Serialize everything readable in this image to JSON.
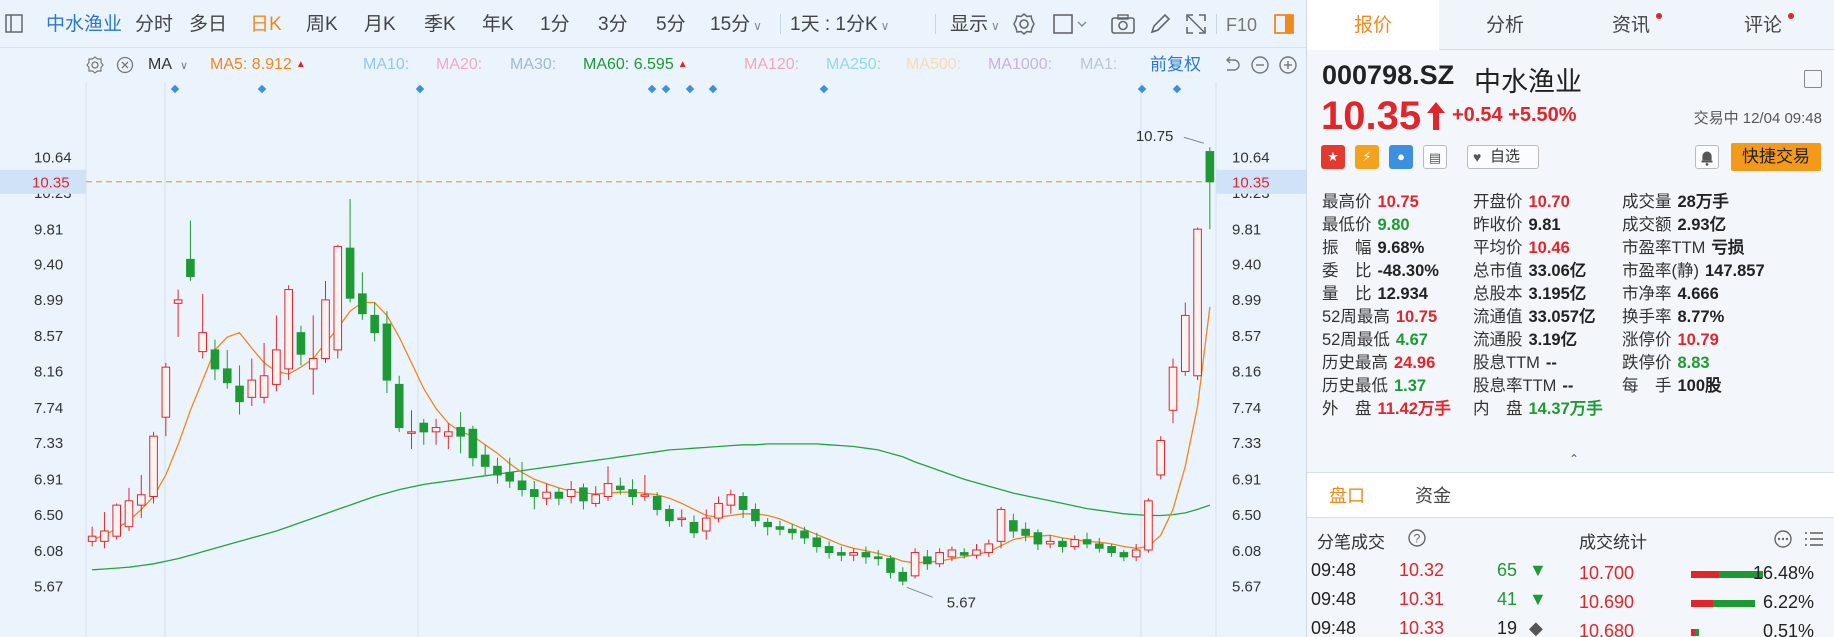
{
  "toolbar": {
    "stock_name": "中水渔业",
    "periods": [
      "分时",
      "多日",
      "日K",
      "周K",
      "月K",
      "季K",
      "年K",
      "1分",
      "3分",
      "5分",
      "15分"
    ],
    "active_period": "日K",
    "combo": "1天 : 1分K",
    "display": "显示",
    "f10": "F10"
  },
  "ma_row": {
    "ma_label": "MA",
    "items": [
      {
        "text": "MA5:  8.912",
        "color": "#f0871d",
        "arrow": "▲"
      },
      {
        "text": "MA10:",
        "color": "#8fc8f3",
        "arrow": ""
      },
      {
        "text": "MA20:",
        "color": "#f2a8c7",
        "arrow": ""
      },
      {
        "text": "MA30:",
        "color": "#9fb7d8",
        "arrow": ""
      },
      {
        "text": "MA60:  6.595",
        "color": "#1e9a35",
        "arrow": "▲"
      },
      {
        "text": "MA120:",
        "color": "#f2a8b8",
        "arrow": ""
      },
      {
        "text": "MA250:",
        "color": "#8fd8ef",
        "arrow": ""
      },
      {
        "text": "MA500:",
        "color": "#f7dcb0",
        "arrow": ""
      },
      {
        "text": "MA1000:",
        "color": "#c9b2e3",
        "arrow": ""
      },
      {
        "text": "MA1:",
        "color": "#b9c6d8",
        "arrow": ""
      }
    ],
    "adjust": "前复权"
  },
  "chart_data": {
    "type": "candlestick",
    "y_ticks": [
      "10.64",
      "10.23",
      "9.81",
      "9.40",
      "8.99",
      "8.57",
      "8.16",
      "7.74",
      "7.33",
      "6.91",
      "6.50",
      "6.08",
      "5.67"
    ],
    "ylim": [
      5.5,
      10.95
    ],
    "current_price": "10.35",
    "max_label": "10.75",
    "min_label": "5.67",
    "candles": [
      [
        6.18,
        6.24,
        6.35,
        6.12
      ],
      [
        6.18,
        6.3,
        6.52,
        6.1
      ],
      [
        6.24,
        6.6,
        6.62,
        6.2
      ],
      [
        6.35,
        6.65,
        6.8,
        6.3
      ],
      [
        6.6,
        6.72,
        6.95,
        6.45
      ],
      [
        6.7,
        7.4,
        7.45,
        6.62
      ],
      [
        7.62,
        8.2,
        8.25,
        7.4
      ],
      [
        8.94,
        8.98,
        9.1,
        8.55
      ],
      [
        9.45,
        9.25,
        9.9,
        9.2
      ],
      [
        8.38,
        8.6,
        9.05,
        8.3
      ],
      [
        8.4,
        8.18,
        8.52,
        8.05
      ],
      [
        8.18,
        8.02,
        8.4,
        7.95
      ],
      [
        7.98,
        7.8,
        8.22,
        7.65
      ],
      [
        7.85,
        8.05,
        8.3,
        7.75
      ],
      [
        7.85,
        8.1,
        8.48,
        7.78
      ],
      [
        8.0,
        8.4,
        8.8,
        7.92
      ],
      [
        8.18,
        9.1,
        9.15,
        8.05
      ],
      [
        8.6,
        8.35,
        8.68,
        8.22
      ],
      [
        8.18,
        8.3,
        8.8,
        7.88
      ],
      [
        8.3,
        8.98,
        9.2,
        8.25
      ],
      [
        8.4,
        9.6,
        9.62,
        8.3
      ],
      [
        9.58,
        9.0,
        10.15,
        8.95
      ],
      [
        9.05,
        8.82,
        9.3,
        8.75
      ],
      [
        8.8,
        8.6,
        8.95,
        8.5
      ],
      [
        8.7,
        8.05,
        8.85,
        7.9
      ],
      [
        8.0,
        7.5,
        8.1,
        7.45
      ],
      [
        7.45,
        7.45,
        7.7,
        7.25
      ],
      [
        7.55,
        7.45,
        7.6,
        7.3
      ],
      [
        7.45,
        7.5,
        7.6,
        7.3
      ],
      [
        7.4,
        7.45,
        7.55,
        7.25
      ],
      [
        7.5,
        7.4,
        7.68,
        7.2
      ],
      [
        7.48,
        7.15,
        7.52,
        7.05
      ],
      [
        7.18,
        7.05,
        7.3,
        6.95
      ],
      [
        7.05,
        6.95,
        7.15,
        6.85
      ],
      [
        6.98,
        6.88,
        7.15,
        6.8
      ],
      [
        6.88,
        6.78,
        7.1,
        6.7
      ],
      [
        6.78,
        6.7,
        6.88,
        6.55
      ],
      [
        6.68,
        6.75,
        6.85,
        6.6
      ],
      [
        6.75,
        6.68,
        6.8,
        6.6
      ],
      [
        6.7,
        6.78,
        6.88,
        6.62
      ],
      [
        6.8,
        6.65,
        6.85,
        6.55
      ],
      [
        6.62,
        6.72,
        6.82,
        6.58
      ],
      [
        6.7,
        6.85,
        7.05,
        6.65
      ],
      [
        6.82,
        6.78,
        6.92,
        6.72
      ],
      [
        6.78,
        6.7,
        6.9,
        6.6
      ],
      [
        6.72,
        6.72,
        6.95,
        6.65
      ],
      [
        6.7,
        6.55,
        6.75,
        6.48
      ],
      [
        6.55,
        6.42,
        6.6,
        6.35
      ],
      [
        6.45,
        6.45,
        6.55,
        6.35
      ],
      [
        6.4,
        6.28,
        6.48,
        6.22
      ],
      [
        6.3,
        6.45,
        6.55,
        6.2
      ],
      [
        6.45,
        6.62,
        6.7,
        6.4
      ],
      [
        6.6,
        6.72,
        6.78,
        6.5
      ],
      [
        6.7,
        6.55,
        6.75,
        6.45
      ],
      [
        6.55,
        6.42,
        6.62,
        6.35
      ],
      [
        6.4,
        6.35,
        6.45,
        6.25
      ],
      [
        6.35,
        6.32,
        6.42,
        6.25
      ],
      [
        6.32,
        6.28,
        6.38,
        6.2
      ],
      [
        6.3,
        6.22,
        6.35,
        6.15
      ],
      [
        6.22,
        6.12,
        6.28,
        6.05
      ],
      [
        6.12,
        6.05,
        6.18,
        5.98
      ],
      [
        6.05,
        6.02,
        6.12,
        5.95
      ],
      [
        6.02,
        6.05,
        6.1,
        5.95
      ],
      [
        6.05,
        6.0,
        6.12,
        5.92
      ],
      [
        6.0,
        5.98,
        6.08,
        5.9
      ],
      [
        5.98,
        5.82,
        6.02,
        5.75
      ],
      [
        5.82,
        5.72,
        5.88,
        5.67
      ],
      [
        5.78,
        6.05,
        6.1,
        5.75
      ],
      [
        6.0,
        5.92,
        6.08,
        5.85
      ],
      [
        5.92,
        6.05,
        6.1,
        5.88
      ],
      [
        6.0,
        6.08,
        6.12,
        5.95
      ],
      [
        6.05,
        6.02,
        6.1,
        5.98
      ],
      [
        6.02,
        6.08,
        6.15,
        5.98
      ],
      [
        6.05,
        6.15,
        6.2,
        6.0
      ],
      [
        6.18,
        6.55,
        6.58,
        6.1
      ],
      [
        6.42,
        6.3,
        6.5,
        6.22
      ],
      [
        6.32,
        6.25,
        6.4,
        6.18
      ],
      [
        6.28,
        6.15,
        6.32,
        6.08
      ],
      [
        6.15,
        6.18,
        6.25,
        6.1
      ],
      [
        6.18,
        6.12,
        6.22,
        6.05
      ],
      [
        6.12,
        6.2,
        6.25,
        6.08
      ],
      [
        6.2,
        6.15,
        6.28,
        6.1
      ],
      [
        6.15,
        6.1,
        6.22,
        6.05
      ],
      [
        6.12,
        6.05,
        6.15,
        6.0
      ],
      [
        6.05,
        6.0,
        6.08,
        5.95
      ],
      [
        6.0,
        6.08,
        6.15,
        5.95
      ],
      [
        6.08,
        6.65,
        6.68,
        6.05
      ],
      [
        6.95,
        7.35,
        7.4,
        6.9
      ],
      [
        7.7,
        8.2,
        8.3,
        7.55
      ],
      [
        8.15,
        8.8,
        8.95,
        8.1
      ],
      [
        8.1,
        9.8,
        9.82,
        8.05
      ],
      [
        10.7,
        10.35,
        10.75,
        9.8
      ]
    ],
    "ma5": [
      6.2,
      6.25,
      6.33,
      6.42,
      6.55,
      6.7,
      6.95,
      7.3,
      7.7,
      8.05,
      8.4,
      8.55,
      8.6,
      8.42,
      8.25,
      8.15,
      8.12,
      8.2,
      8.3,
      8.48,
      8.65,
      8.85,
      8.95,
      8.95,
      8.8,
      8.55,
      8.25,
      7.95,
      7.72,
      7.55,
      7.45,
      7.4,
      7.3,
      7.2,
      7.08,
      6.98,
      6.9,
      6.85,
      6.8,
      6.76,
      6.74,
      6.73,
      6.74,
      6.75,
      6.75,
      6.74,
      6.72,
      6.68,
      6.62,
      6.55,
      6.48,
      6.46,
      6.48,
      6.5,
      6.5,
      6.48,
      6.44,
      6.38,
      6.32,
      6.26,
      6.2,
      6.14,
      6.1,
      6.07,
      6.04,
      6.0,
      5.95,
      5.93,
      5.94,
      5.95,
      5.98,
      6.0,
      6.03,
      6.06,
      6.13,
      6.2,
      6.23,
      6.24,
      6.25,
      6.22,
      6.2,
      6.18,
      6.17,
      6.15,
      6.12,
      6.1,
      6.12,
      6.25,
      6.55,
      7.05,
      7.75,
      8.9
    ],
    "ma60": [
      5.85,
      5.86,
      5.87,
      5.88,
      5.9,
      5.92,
      5.95,
      5.98,
      6.02,
      6.06,
      6.1,
      6.14,
      6.18,
      6.22,
      6.26,
      6.3,
      6.35,
      6.4,
      6.45,
      6.5,
      6.55,
      6.6,
      6.65,
      6.7,
      6.74,
      6.78,
      6.81,
      6.84,
      6.86,
      6.88,
      6.9,
      6.92,
      6.94,
      6.96,
      6.98,
      7.0,
      7.02,
      7.04,
      7.06,
      7.08,
      7.1,
      7.12,
      7.14,
      7.16,
      7.18,
      7.2,
      7.22,
      7.24,
      7.25,
      7.26,
      7.27,
      7.28,
      7.29,
      7.3,
      7.3,
      7.31,
      7.31,
      7.31,
      7.31,
      7.31,
      7.3,
      7.29,
      7.28,
      7.26,
      7.24,
      7.2,
      7.16,
      7.1,
      7.05,
      7.0,
      6.95,
      6.9,
      6.86,
      6.82,
      6.78,
      6.74,
      6.71,
      6.68,
      6.65,
      6.62,
      6.59,
      6.56,
      6.54,
      6.52,
      6.5,
      6.49,
      6.48,
      6.48,
      6.49,
      6.51,
      6.55,
      6.6
    ]
  },
  "quote": {
    "tabs": [
      "报价",
      "分析",
      "资讯",
      "评论"
    ],
    "code": "000798.SZ",
    "name": "中水渔业",
    "price": "10.35",
    "change": "+0.54",
    "change_pct": "+5.50%",
    "status": "交易中 12/04 09:48",
    "watch_label": "自选",
    "trade_button": "快捷交易",
    "stats": [
      [
        {
          "label": "最高价",
          "value": "10.75",
          "color": "red"
        },
        {
          "label": "开盘价",
          "value": "10.70",
          "color": "red"
        },
        {
          "label": "成交量",
          "value": "28万手",
          "color": "dark"
        }
      ],
      [
        {
          "label": "最低价",
          "value": "9.80",
          "color": "green"
        },
        {
          "label": "昨收价",
          "value": "9.81",
          "color": "dark"
        },
        {
          "label": "成交额",
          "value": "2.93亿",
          "color": "dark"
        }
      ],
      [
        {
          "label": "振　幅",
          "value": "9.68%",
          "color": "dark"
        },
        {
          "label": "平均价",
          "value": "10.46",
          "color": "red"
        },
        {
          "label": "市盈率TTM",
          "value": "亏损",
          "color": "dark"
        }
      ],
      [
        {
          "label": "委　比",
          "value": "-48.30%",
          "color": "dark"
        },
        {
          "label": "总市值",
          "value": "33.06亿",
          "color": "dark"
        },
        {
          "label": "市盈率(静)",
          "value": "147.857",
          "color": "dark"
        }
      ],
      [
        {
          "label": "量　比",
          "value": "12.934",
          "color": "dark"
        },
        {
          "label": "总股本",
          "value": "3.195亿",
          "color": "dark"
        },
        {
          "label": "市净率",
          "value": "4.666",
          "color": "dark"
        }
      ],
      [
        {
          "label": "52周最高",
          "value": "10.75",
          "color": "red"
        },
        {
          "label": "流通值",
          "value": "33.057亿",
          "color": "dark"
        },
        {
          "label": "换手率",
          "value": "8.77%",
          "color": "dark"
        }
      ],
      [
        {
          "label": "52周最低",
          "value": "4.67",
          "color": "green"
        },
        {
          "label": "流通股",
          "value": "3.19亿",
          "color": "dark"
        },
        {
          "label": "涨停价",
          "value": "10.79",
          "color": "red"
        }
      ],
      [
        {
          "label": "历史最高",
          "value": "24.96",
          "color": "red"
        },
        {
          "label": "股息TTM",
          "value": "--",
          "color": "dark"
        },
        {
          "label": "跌停价",
          "value": "8.83",
          "color": "green"
        }
      ],
      [
        {
          "label": "历史最低",
          "value": "1.37",
          "color": "green"
        },
        {
          "label": "股息率TTM",
          "value": "--",
          "color": "dark"
        },
        {
          "label": "每　手",
          "value": "100股",
          "color": "dark"
        }
      ],
      [
        {
          "label": "外　盘",
          "value": "11.42万手",
          "color": "red"
        },
        {
          "label": "内　盘",
          "value": "14.37万手",
          "color": "green"
        }
      ]
    ],
    "subtabs": [
      "盘口",
      "资金"
    ],
    "ticks_title": "分笔成交",
    "stats_title": "成交统计",
    "ticks": [
      {
        "time": "09:48",
        "price": "10.32",
        "vol": "65",
        "dir": "▼"
      },
      {
        "time": "09:48",
        "price": "10.31",
        "vol": "41",
        "dir": "▼"
      },
      {
        "time": "09:48",
        "price": "10.33",
        "vol": "19",
        "dir": "◆"
      }
    ],
    "dist": [
      {
        "price": "10.700",
        "pct": "16.48%",
        "red": 0.35,
        "green": 0.55
      },
      {
        "price": "10.690",
        "pct": "6.22%",
        "red": 0.28,
        "green": 0.52
      },
      {
        "price": "10.680",
        "pct": "0.51%",
        "red": 0.05,
        "green": 0.05
      }
    ]
  }
}
